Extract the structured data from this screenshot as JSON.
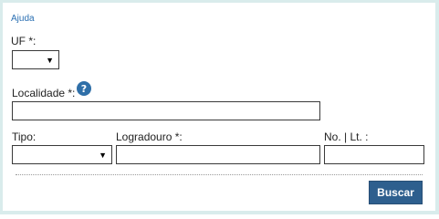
{
  "help": {
    "link_label": "Ajuda",
    "icon": "question-mark-icon",
    "icon_glyph": "?"
  },
  "form": {
    "uf": {
      "label": "UF *:",
      "selected": ""
    },
    "localidade": {
      "label": "Localidade *:",
      "value": ""
    },
    "tipo": {
      "label": "Tipo:",
      "selected": ""
    },
    "logradouro": {
      "label": "Logradouro *:",
      "value": ""
    },
    "numero_lote": {
      "label": "No. | Lt. :",
      "value": ""
    }
  },
  "actions": {
    "search_label": "Buscar"
  },
  "colors": {
    "accent": "#2e5f8e",
    "link": "#2a6fb2",
    "frame": "#d9ecec"
  }
}
